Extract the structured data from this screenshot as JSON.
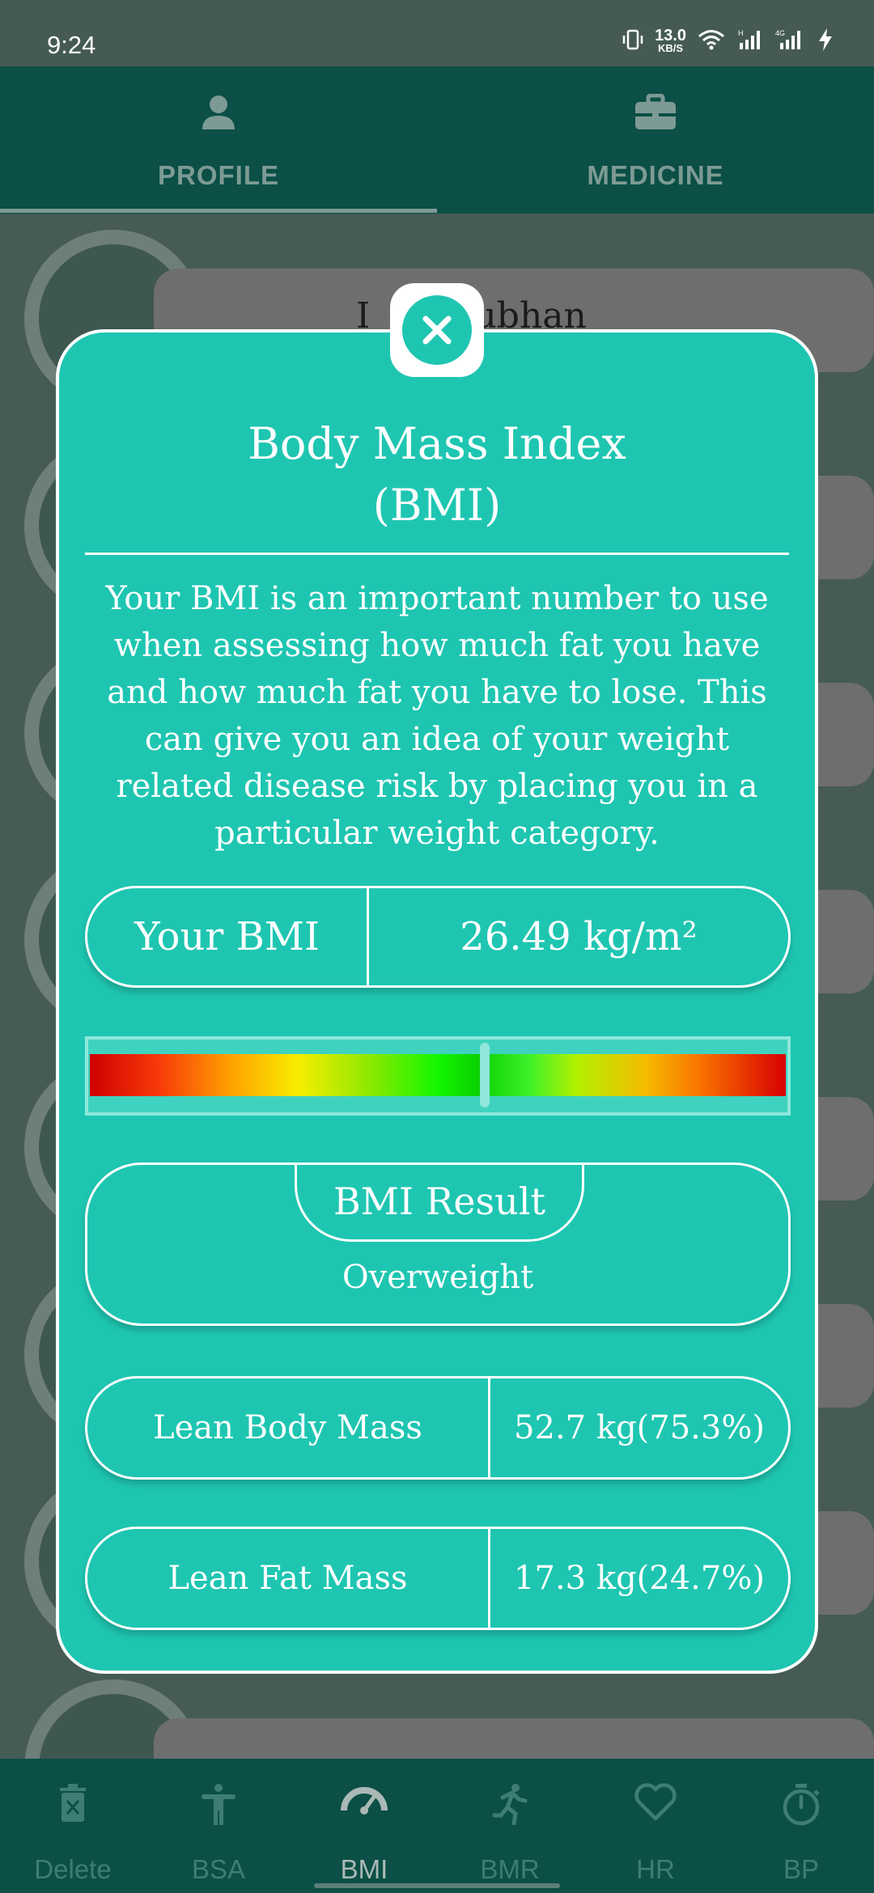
{
  "status_bar": {
    "time": "9:24",
    "net_speed_value": "13.0",
    "net_speed_unit": "KB/S",
    "icons": [
      "vibrate-icon",
      "wifi-icon",
      "signal-icon",
      "signal-4g-icon",
      "battery-charging-icon"
    ]
  },
  "top_tabs": [
    {
      "label": "PROFILE",
      "icon": "person-icon",
      "active": true
    },
    {
      "label": "MEDICINE",
      "icon": "briefcase-medical-icon",
      "active": false
    }
  ],
  "background": {
    "name_partial": "Subhan",
    "name_initial": "I"
  },
  "modal": {
    "title_line1": "Body Mass Index",
    "title_line2": "(BMI)",
    "description": "Your BMI is an important number to use when assessing how much fat you have and how much fat you have to lose. This can give you an idea of your weight related disease risk by placing you in a particular weight category.",
    "bmi_label": "Your BMI",
    "bmi_value": "26.49  kg/m²",
    "scale_marker_fraction": 0.567,
    "result_label": "BMI Result",
    "result_value": "Overweight",
    "lean_body_mass_label": "Lean Body Mass",
    "lean_body_mass_value": "52.7 kg(75.3%)",
    "lean_fat_mass_label": "Lean Fat Mass",
    "lean_fat_mass_value": "17.3 kg(24.7%)"
  },
  "bottom_nav": [
    {
      "label": "Delete",
      "icon": "trash-icon",
      "active": false
    },
    {
      "label": "BSA",
      "icon": "body-icon",
      "active": false
    },
    {
      "label": "BMI",
      "icon": "gauge-icon",
      "active": true
    },
    {
      "label": "BMR",
      "icon": "running-icon",
      "active": false
    },
    {
      "label": "HR",
      "icon": "heart-icon",
      "active": false
    },
    {
      "label": "BP",
      "icon": "stopwatch-icon",
      "active": false
    }
  ],
  "colors": {
    "modal_bg": "#1ec6b1",
    "header_bg": "#0b4f46",
    "overlay_bg": "#465b55"
  }
}
